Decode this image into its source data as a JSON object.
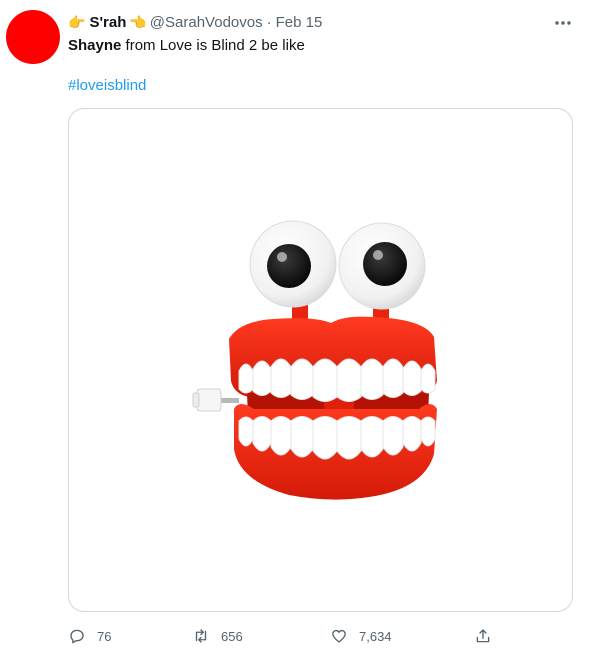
{
  "tweet": {
    "author": {
      "display_name": "S'rah",
      "emoji_left": "👉",
      "emoji_right": "👈",
      "handle": "@SarahVodovos",
      "separator": "·",
      "date": "Feb 15",
      "avatar_color": "#ff0000"
    },
    "text_bold": "Shayne",
    "text_rest": " from Love is Blind 2 be like",
    "hashtag": "#loveisblind",
    "media": {
      "subject": "wind-up chattering teeth toy with googly eyes"
    },
    "actions": {
      "reply_count": "76",
      "retweet_count": "656",
      "like_count": "7,634"
    },
    "colors": {
      "link": "#1d9bf0",
      "secondary_text": "#536471",
      "border": "#cfd9de"
    }
  }
}
